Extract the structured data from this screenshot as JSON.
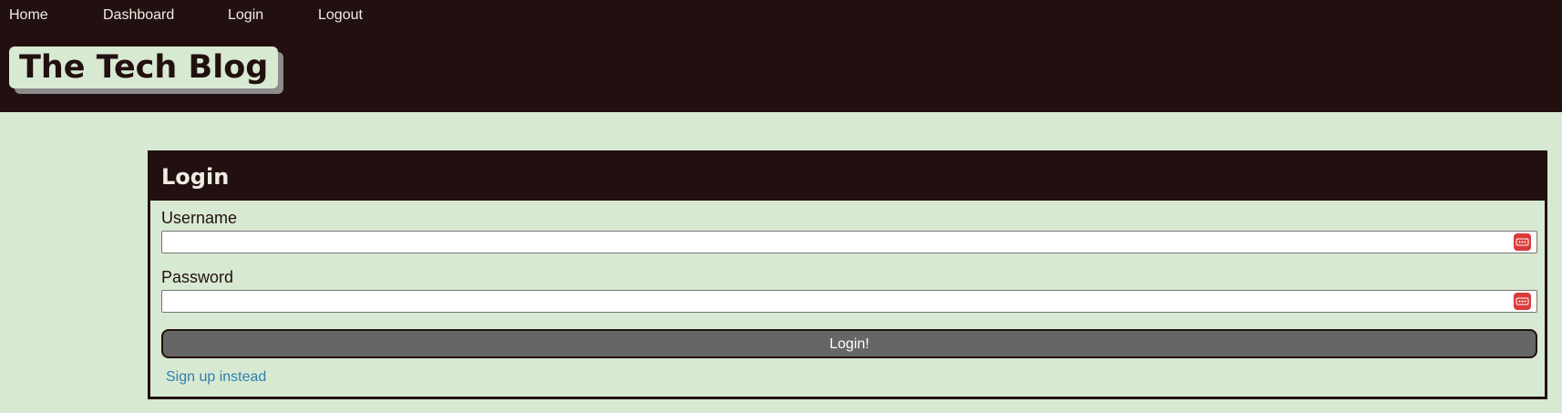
{
  "nav": {
    "items": [
      {
        "label": "Home"
      },
      {
        "label": "Dashboard"
      },
      {
        "label": "Login"
      },
      {
        "label": "Logout"
      }
    ]
  },
  "brand": {
    "title": "The Tech Blog"
  },
  "login_card": {
    "title": "Login",
    "username": {
      "label": "Username",
      "value": "",
      "placeholder": ""
    },
    "password": {
      "label": "Password",
      "value": "",
      "placeholder": ""
    },
    "submit_label": "Login!",
    "signup_link": "Sign up instead"
  },
  "colors": {
    "header_bg": "#221010",
    "page_bg": "#d8e9d2",
    "button_bg": "#666666",
    "link": "#2d7fb0",
    "password_manager_icon": "#d93a3a"
  },
  "icons": {
    "field_icon": "password-manager-icon"
  }
}
